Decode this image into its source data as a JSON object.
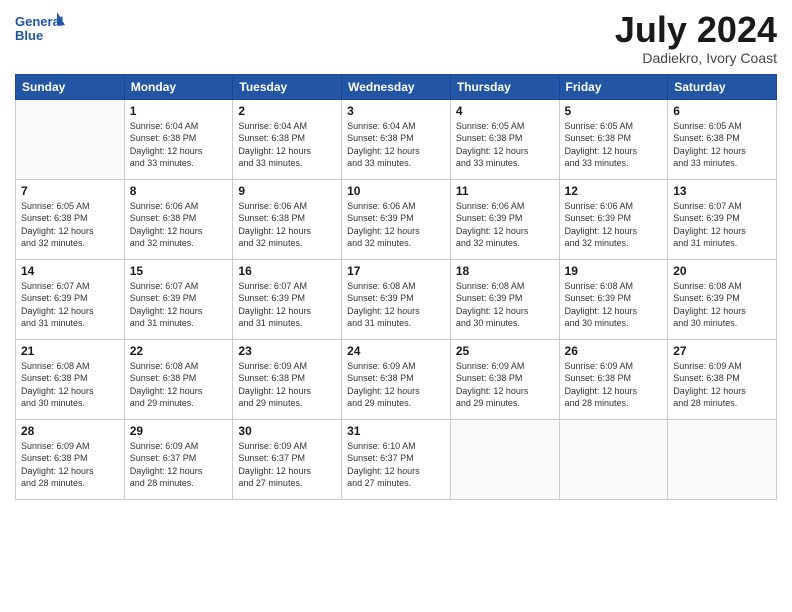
{
  "logo": {
    "line1": "General",
    "line2": "Blue"
  },
  "title": "July 2024",
  "location": "Dadiekro, Ivory Coast",
  "days_header": [
    "Sunday",
    "Monday",
    "Tuesday",
    "Wednesday",
    "Thursday",
    "Friday",
    "Saturday"
  ],
  "weeks": [
    [
      {
        "day": "",
        "info": ""
      },
      {
        "day": "1",
        "info": "Sunrise: 6:04 AM\nSunset: 6:38 PM\nDaylight: 12 hours\nand 33 minutes."
      },
      {
        "day": "2",
        "info": "Sunrise: 6:04 AM\nSunset: 6:38 PM\nDaylight: 12 hours\nand 33 minutes."
      },
      {
        "day": "3",
        "info": "Sunrise: 6:04 AM\nSunset: 6:38 PM\nDaylight: 12 hours\nand 33 minutes."
      },
      {
        "day": "4",
        "info": "Sunrise: 6:05 AM\nSunset: 6:38 PM\nDaylight: 12 hours\nand 33 minutes."
      },
      {
        "day": "5",
        "info": "Sunrise: 6:05 AM\nSunset: 6:38 PM\nDaylight: 12 hours\nand 33 minutes."
      },
      {
        "day": "6",
        "info": "Sunrise: 6:05 AM\nSunset: 6:38 PM\nDaylight: 12 hours\nand 33 minutes."
      }
    ],
    [
      {
        "day": "7",
        "info": "Sunrise: 6:05 AM\nSunset: 6:38 PM\nDaylight: 12 hours\nand 32 minutes."
      },
      {
        "day": "8",
        "info": "Sunrise: 6:06 AM\nSunset: 6:38 PM\nDaylight: 12 hours\nand 32 minutes."
      },
      {
        "day": "9",
        "info": "Sunrise: 6:06 AM\nSunset: 6:38 PM\nDaylight: 12 hours\nand 32 minutes."
      },
      {
        "day": "10",
        "info": "Sunrise: 6:06 AM\nSunset: 6:39 PM\nDaylight: 12 hours\nand 32 minutes."
      },
      {
        "day": "11",
        "info": "Sunrise: 6:06 AM\nSunset: 6:39 PM\nDaylight: 12 hours\nand 32 minutes."
      },
      {
        "day": "12",
        "info": "Sunrise: 6:06 AM\nSunset: 6:39 PM\nDaylight: 12 hours\nand 32 minutes."
      },
      {
        "day": "13",
        "info": "Sunrise: 6:07 AM\nSunset: 6:39 PM\nDaylight: 12 hours\nand 31 minutes."
      }
    ],
    [
      {
        "day": "14",
        "info": "Sunrise: 6:07 AM\nSunset: 6:39 PM\nDaylight: 12 hours\nand 31 minutes."
      },
      {
        "day": "15",
        "info": "Sunrise: 6:07 AM\nSunset: 6:39 PM\nDaylight: 12 hours\nand 31 minutes."
      },
      {
        "day": "16",
        "info": "Sunrise: 6:07 AM\nSunset: 6:39 PM\nDaylight: 12 hours\nand 31 minutes."
      },
      {
        "day": "17",
        "info": "Sunrise: 6:08 AM\nSunset: 6:39 PM\nDaylight: 12 hours\nand 31 minutes."
      },
      {
        "day": "18",
        "info": "Sunrise: 6:08 AM\nSunset: 6:39 PM\nDaylight: 12 hours\nand 30 minutes."
      },
      {
        "day": "19",
        "info": "Sunrise: 6:08 AM\nSunset: 6:39 PM\nDaylight: 12 hours\nand 30 minutes."
      },
      {
        "day": "20",
        "info": "Sunrise: 6:08 AM\nSunset: 6:39 PM\nDaylight: 12 hours\nand 30 minutes."
      }
    ],
    [
      {
        "day": "21",
        "info": "Sunrise: 6:08 AM\nSunset: 6:38 PM\nDaylight: 12 hours\nand 30 minutes."
      },
      {
        "day": "22",
        "info": "Sunrise: 6:08 AM\nSunset: 6:38 PM\nDaylight: 12 hours\nand 29 minutes."
      },
      {
        "day": "23",
        "info": "Sunrise: 6:09 AM\nSunset: 6:38 PM\nDaylight: 12 hours\nand 29 minutes."
      },
      {
        "day": "24",
        "info": "Sunrise: 6:09 AM\nSunset: 6:38 PM\nDaylight: 12 hours\nand 29 minutes."
      },
      {
        "day": "25",
        "info": "Sunrise: 6:09 AM\nSunset: 6:38 PM\nDaylight: 12 hours\nand 29 minutes."
      },
      {
        "day": "26",
        "info": "Sunrise: 6:09 AM\nSunset: 6:38 PM\nDaylight: 12 hours\nand 28 minutes."
      },
      {
        "day": "27",
        "info": "Sunrise: 6:09 AM\nSunset: 6:38 PM\nDaylight: 12 hours\nand 28 minutes."
      }
    ],
    [
      {
        "day": "28",
        "info": "Sunrise: 6:09 AM\nSunset: 6:38 PM\nDaylight: 12 hours\nand 28 minutes."
      },
      {
        "day": "29",
        "info": "Sunrise: 6:09 AM\nSunset: 6:37 PM\nDaylight: 12 hours\nand 28 minutes."
      },
      {
        "day": "30",
        "info": "Sunrise: 6:09 AM\nSunset: 6:37 PM\nDaylight: 12 hours\nand 27 minutes."
      },
      {
        "day": "31",
        "info": "Sunrise: 6:10 AM\nSunset: 6:37 PM\nDaylight: 12 hours\nand 27 minutes."
      },
      {
        "day": "",
        "info": ""
      },
      {
        "day": "",
        "info": ""
      },
      {
        "day": "",
        "info": ""
      }
    ]
  ]
}
